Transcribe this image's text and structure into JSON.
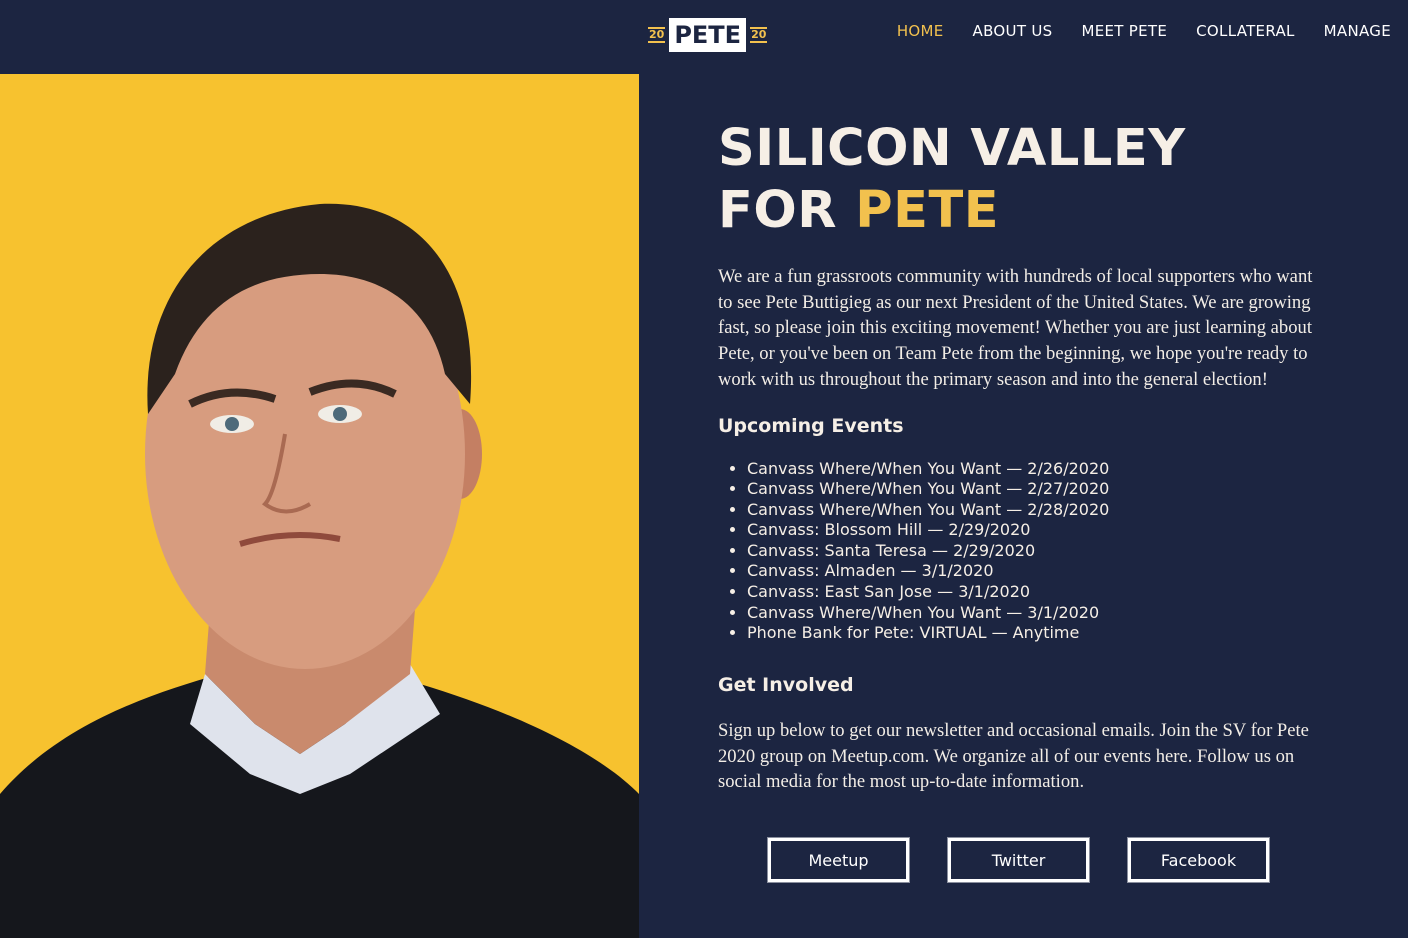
{
  "header": {
    "logo": {
      "year_top": "20",
      "year_bottom": "20",
      "wordmark": "PETE"
    },
    "nav": [
      {
        "label": "HOME",
        "active": true
      },
      {
        "label": "ABOUT US",
        "active": false
      },
      {
        "label": "MEET PETE",
        "active": false
      },
      {
        "label": "COLLATERAL",
        "active": false
      },
      {
        "label": "MANAGE",
        "active": false
      }
    ]
  },
  "hero": {
    "title_line1": "SILICON VALLEY",
    "title_line2_prefix": "FOR ",
    "title_line2_accent": "PETE",
    "intro": "We are a fun grassroots community with hundreds of local supporters who want to see Pete Buttigieg as our next President of the United States. We are growing fast, so please join this exciting movement! Whether you are just learning about Pete, or you've been on Team Pete from the beginning, we hope you're ready to work with us throughout the primary season and into the general election!"
  },
  "events": {
    "heading": "Upcoming Events",
    "items": [
      "Canvass Where/When You Want — 2/26/2020",
      "Canvass Where/When You Want — 2/27/2020",
      "Canvass Where/When You Want — 2/28/2020",
      "Canvass: Blossom Hill — 2/29/2020",
      "Canvass: Santa Teresa — 2/29/2020",
      "Canvass: Almaden — 3/1/2020",
      "Canvass: East San Jose — 3/1/2020",
      "Canvass Where/When You Want — 3/1/2020",
      "Phone Bank for Pete: VIRTUAL — Anytime"
    ]
  },
  "get_involved": {
    "heading": "Get Involved",
    "text": "Sign up below to get our newsletter and occasional emails. Join the SV for Pete 2020 group on Meetup.com. We organize all of our events here. Follow us on social media for the most up-to-date information.",
    "buttons": [
      "Meetup",
      "Twitter",
      "Facebook"
    ]
  },
  "colors": {
    "navy": "#1c2541",
    "gold": "#f2c14e",
    "photo_background": "#f7c22f"
  }
}
